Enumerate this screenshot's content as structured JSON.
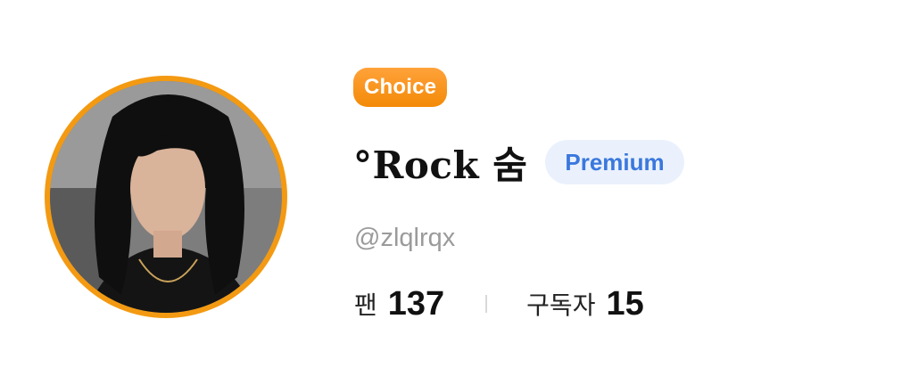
{
  "profile": {
    "choice_badge": "Choice",
    "display_name": "°Rock 숨",
    "premium_badge": "Premium",
    "handle": "@zlqlrqx",
    "avatar": "profile-photo"
  },
  "stats": {
    "fans_label": "팬",
    "fans_value": "137",
    "subscribers_label": "구독자",
    "subscribers_value": "15"
  },
  "colors": {
    "accent_orange": "#F39A12",
    "premium_blue": "#3A78DD",
    "premium_bg": "#EAF1FD"
  }
}
